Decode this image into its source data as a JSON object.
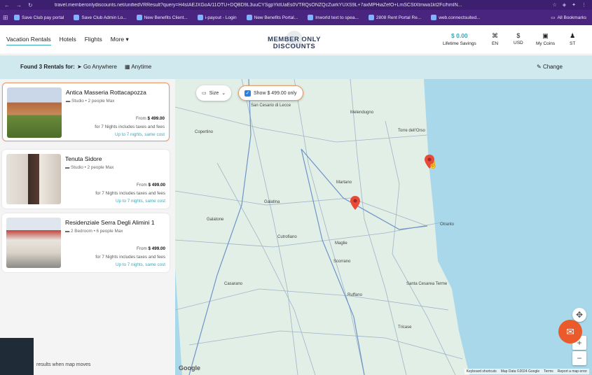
{
  "browser": {
    "url": "travel.memberonlydiscounts.net/unifiedVRResult?query=H4sIAEJXGoA/11OTU+DQBD9L3uuCYSgpYktUaEs0VTRQsONZQcZuirkYUXS9L+7axMPHiaZefO+LmSCStXtmwa1kt2Fc/hmIN...",
    "bookmarks": [
      "Save Club pay portal",
      "Save Club Admin Lo...",
      "New Benefits Client...",
      "i-payout - Login",
      "New Benefits Portal...",
      "Inworld text to spea...",
      "2808 Rent Portal Re...",
      "web.connectsuited..."
    ],
    "all_bookmarks": "All Bookmarks"
  },
  "header": {
    "nav": [
      "Vacation Rentals",
      "Hotels",
      "Flights",
      "More"
    ],
    "logo_line1": "MEMBER ONLY",
    "logo_line2": "DISCOUNTS",
    "coins_value": "$ 0.00",
    "coins_label": "Lifetime Savings",
    "lang": "EN",
    "currency_symbol": "$",
    "currency": "USD",
    "my_coins": "My Coins",
    "user_initials": "ST"
  },
  "search": {
    "found": "Found 3 Rentals for:",
    "where": "Go Anywhere",
    "when": "Anytime",
    "change": "Change"
  },
  "listings": [
    {
      "name": "Antica Masseria Rottacapozza",
      "meta": "Studio • 2 people Max",
      "from_label": "From",
      "price": "$ 499.00",
      "nights": "for 7 Nights includes taxes and fees",
      "flex": "Up to 7 nights, same cost"
    },
    {
      "name": "Tenuta Sidore",
      "meta": "Studio • 2 people Max",
      "from_label": "From",
      "price": "$ 499.00",
      "nights": "for 7 Nights includes taxes and fees",
      "flex": "Up to 7 nights, same cost"
    },
    {
      "name": "Residenziale Serra Degli Alimini 1",
      "meta": "2 Bedroom • 6 people Max",
      "from_label": "From",
      "price": "$ 499.00",
      "nights": "for 7 Nights includes taxes and fees",
      "flex": "Up to 7 nights, same cost"
    }
  ],
  "map": {
    "size_filter": "Size",
    "price_filter": "Show $ 499.00 only",
    "map_moves": "results when map moves",
    "google": "Google",
    "attribution": [
      "Keyboard shortcuts",
      "Map Data ©2024 Google",
      "Terms",
      "Report a map error"
    ],
    "towns": [
      "San Cesario di Lecce",
      "Copertino",
      "Melendugno",
      "Torre dell'Orso",
      "Martano",
      "Galatina",
      "Galatone",
      "Cutrofiano",
      "Maglie",
      "Otranto",
      "Scorrano",
      "Casarano",
      "Ruffano",
      "Tricase",
      "Santa Cesarea Terme"
    ]
  },
  "colors": {
    "accent": "#38a9b7",
    "pin": "#e84a3a",
    "chat": "#ea5a2a",
    "sea": "#a9d8ea"
  }
}
